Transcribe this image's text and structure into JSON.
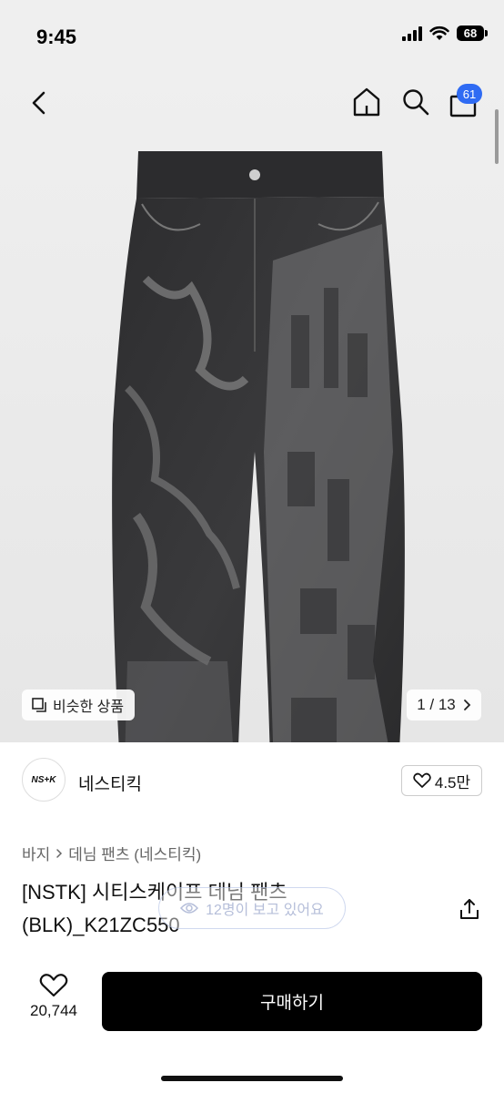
{
  "status_bar": {
    "time": "9:45",
    "battery": "68"
  },
  "nav": {
    "cart_count": "61"
  },
  "image": {
    "similar_label": "비슷한 상품",
    "page_indicator": "1 / 13"
  },
  "brand": {
    "logo_text": "NS+K",
    "name": "네스티킥",
    "likes": "4.5만"
  },
  "product": {
    "category_root": "바지",
    "category_sub": "데님 팬츠 (네스티킥)",
    "title": "[NSTK] 시티스케이프 데님 팬츠 (BLK)_K21ZC550",
    "viewers": "12명이 보고 있어요"
  },
  "bottom": {
    "wish_count": "20,744",
    "buy_label": "구매하기"
  },
  "colors": {
    "accent": "#2f6bf3",
    "buy_bg": "#000000"
  }
}
